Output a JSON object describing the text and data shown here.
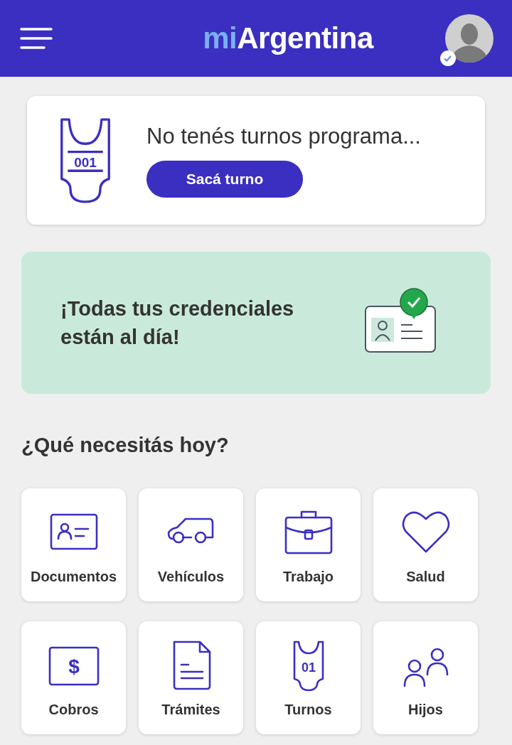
{
  "header": {
    "logo_prefix": "mi",
    "logo_name": "Argentina",
    "avatar_verified": true
  },
  "appointment": {
    "ticket_number": "001",
    "message": "No tenés turnos programa...",
    "button": "Sacá turno"
  },
  "credentials": {
    "message": "¡Todas tus credenciales están al día!",
    "verified": true
  },
  "section_title": "¿Qué necesitás hoy?",
  "tiles": [
    {
      "kind": "documents",
      "label": "Documentos"
    },
    {
      "kind": "vehicles",
      "label": "Vehículos"
    },
    {
      "kind": "work",
      "label": "Trabajo"
    },
    {
      "kind": "health",
      "label": "Salud"
    },
    {
      "kind": "payments",
      "label": "Cobros",
      "icon_text": "$"
    },
    {
      "kind": "procedures",
      "label": "Trámites"
    },
    {
      "kind": "appointments",
      "label": "Turnos",
      "icon_text": "01"
    },
    {
      "kind": "children",
      "label": "Hijos"
    }
  ]
}
